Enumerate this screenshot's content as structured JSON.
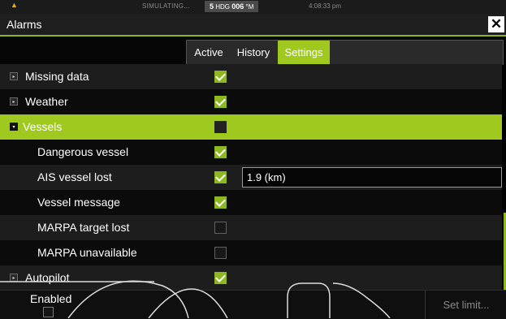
{
  "status_bar": {
    "warning_icon": "warning-icon",
    "simulating": "SIMULATING...",
    "heading_value": "5",
    "heading_label": "HDG",
    "heading_number": "006",
    "heading_unit": "°M",
    "time": "4:08:33 pm"
  },
  "window": {
    "title": "Alarms",
    "close_glyph": "✕"
  },
  "tabs": [
    {
      "label": "Active",
      "active": false
    },
    {
      "label": "History",
      "active": false
    },
    {
      "label": "Settings",
      "active": true
    }
  ],
  "rows": [
    {
      "label": "Missing data",
      "expander": "▸",
      "checked": true
    },
    {
      "label": "Weather",
      "expander": "▸",
      "checked": true
    },
    {
      "label": "Vessels",
      "expander": "▾",
      "checked": false,
      "highlighted": true
    },
    {
      "label": "Dangerous vessel",
      "checked": true
    },
    {
      "label": "AIS vessel lost",
      "checked": true,
      "limit": "1.9 (km)"
    },
    {
      "label": "Vessel message",
      "checked": true
    },
    {
      "label": "MARPA target lost",
      "checked": false
    },
    {
      "label": "MARPA unavailable",
      "checked": false
    },
    {
      "label": "Autopilot",
      "expander": "▸",
      "checked": true
    }
  ],
  "bottom_bar": {
    "enabled_label": "Enabled",
    "set_limit_label": "Set limit..."
  },
  "colors": {
    "accent": "#9fc91e",
    "checkbox_on": "#8db81f",
    "background": "#000000"
  }
}
